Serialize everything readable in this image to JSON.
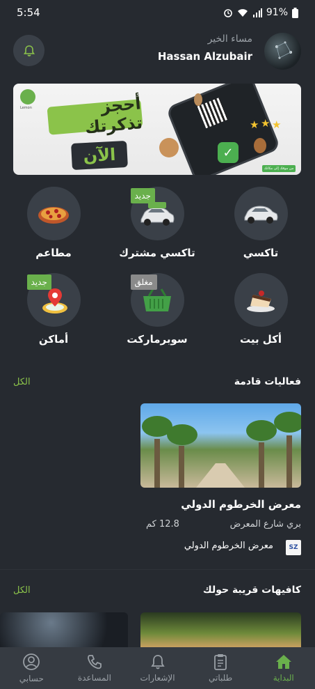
{
  "status": {
    "time": "5:54",
    "battery": "91%"
  },
  "header": {
    "greeting": "مساء الخير",
    "user_name": "Hassan Alzubair"
  },
  "banner": {
    "headline": "أحجز تذكرتك",
    "subline": "الآن",
    "brand": "Lemon",
    "small_tag": "من موقك إلى مكانك"
  },
  "services": [
    {
      "label": "تاكسي",
      "icon": "car-icon",
      "badge": ""
    },
    {
      "label": "تاكسي مشترك",
      "icon": "shared-taxi-icon",
      "badge": "جديد"
    },
    {
      "label": "مطاعم",
      "icon": "pizza-icon",
      "badge": ""
    },
    {
      "label": "أكل بيت",
      "icon": "cake-icon",
      "badge": ""
    },
    {
      "label": "سوبرماركت",
      "icon": "basket-icon",
      "badge": "مغلق"
    },
    {
      "label": "أماكن",
      "icon": "map-pin-icon",
      "badge": "جديد"
    }
  ],
  "events": {
    "title": "فعاليات قادمة",
    "see_all": "الكل",
    "items": [
      {
        "name": "معرض الخرطوم الدولي",
        "address": "بري شارع المعرض",
        "distance": "12.8 كم",
        "organizer": "معرض الخرطوم الدولي",
        "organizer_logo": "SZ"
      }
    ]
  },
  "cafes": {
    "title": "كافيهات قريبة حولك",
    "see_all": "الكل"
  },
  "nav": [
    {
      "label": "البداية",
      "icon": "home-icon",
      "active": true
    },
    {
      "label": "طلباتي",
      "icon": "clipboard-icon",
      "active": false
    },
    {
      "label": "الإشعارات",
      "icon": "bell-icon",
      "active": false
    },
    {
      "label": "المساعدة",
      "icon": "phone-icon",
      "active": false
    },
    {
      "label": "حسابي",
      "icon": "user-circle-icon",
      "active": false
    }
  ],
  "colors": {
    "background": "#262a30",
    "accent": "#6ab04c",
    "card": "#3a4048",
    "nav": "#363b42"
  }
}
